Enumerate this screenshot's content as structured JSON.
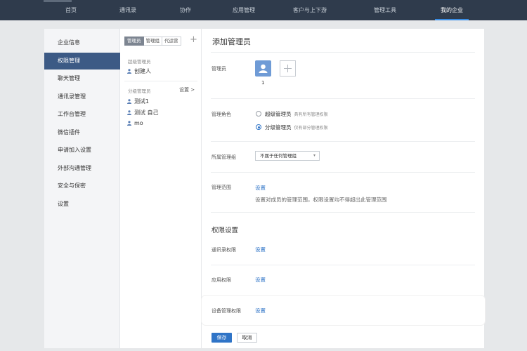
{
  "nav": {
    "items": [
      {
        "label": "首页"
      },
      {
        "label": "通讯录"
      },
      {
        "label": "协作"
      },
      {
        "label": "应用管理"
      },
      {
        "label": "客户与上下游"
      },
      {
        "label": "管理工具"
      },
      {
        "label": "我的企业"
      }
    ],
    "active_index": 6
  },
  "sidebar": {
    "items": [
      {
        "label": "企业信息"
      },
      {
        "label": "权限管理"
      },
      {
        "label": "聊天管理"
      },
      {
        "label": "通讯录管理"
      },
      {
        "label": "工作台管理"
      },
      {
        "label": "微信插件"
      },
      {
        "label": "申请加入设置"
      },
      {
        "label": "外部沟通管理"
      },
      {
        "label": "安全与保密"
      },
      {
        "label": "设置"
      }
    ],
    "active_index": 1
  },
  "admin_panel": {
    "tabs": [
      {
        "label": "管理员"
      },
      {
        "label": "管理组"
      },
      {
        "label": "代运营"
      }
    ],
    "add_symbol": "+",
    "super_title": "超级管理员",
    "super_members": [
      {
        "name": "创建人"
      }
    ],
    "sub_title": "分级管理员",
    "sub_settings": "设置 >",
    "sub_members": [
      {
        "name": "测试1"
      },
      {
        "name": "测试 自己"
      },
      {
        "name": "mo"
      }
    ]
  },
  "form": {
    "title": "添加管理员",
    "admin_label": "管理员",
    "avatar_count": "1",
    "role_label": "管理角色",
    "roles": [
      {
        "name": "超级管理员",
        "desc": "具有所有管理权限",
        "checked": false
      },
      {
        "name": "分级管理员",
        "desc": "仅有部分管理权限",
        "checked": true
      }
    ],
    "group_label": "所属管理组",
    "group_value": "不属于任何管理组",
    "scope_label": "管理范围",
    "scope_link": "设置",
    "scope_desc": "设置对成员的管理范围，权限设置均不得超出此管理范围",
    "perm_section": "权限设置",
    "perms": [
      {
        "label": "通讯录权限",
        "link": "设置"
      },
      {
        "label": "应用权限",
        "link": "设置"
      },
      {
        "label": "设备管理权限",
        "link": "设置"
      }
    ],
    "save": "保存",
    "cancel": "取消"
  },
  "colors": {
    "topbar": "#2f3b4c",
    "active_menu": "#3c5a85",
    "primary": "#2f74c7",
    "avatar": "#6f9bd6"
  },
  "icons": {
    "member": "person-icon",
    "add": "plus-icon",
    "select": "caret-down-icon"
  }
}
